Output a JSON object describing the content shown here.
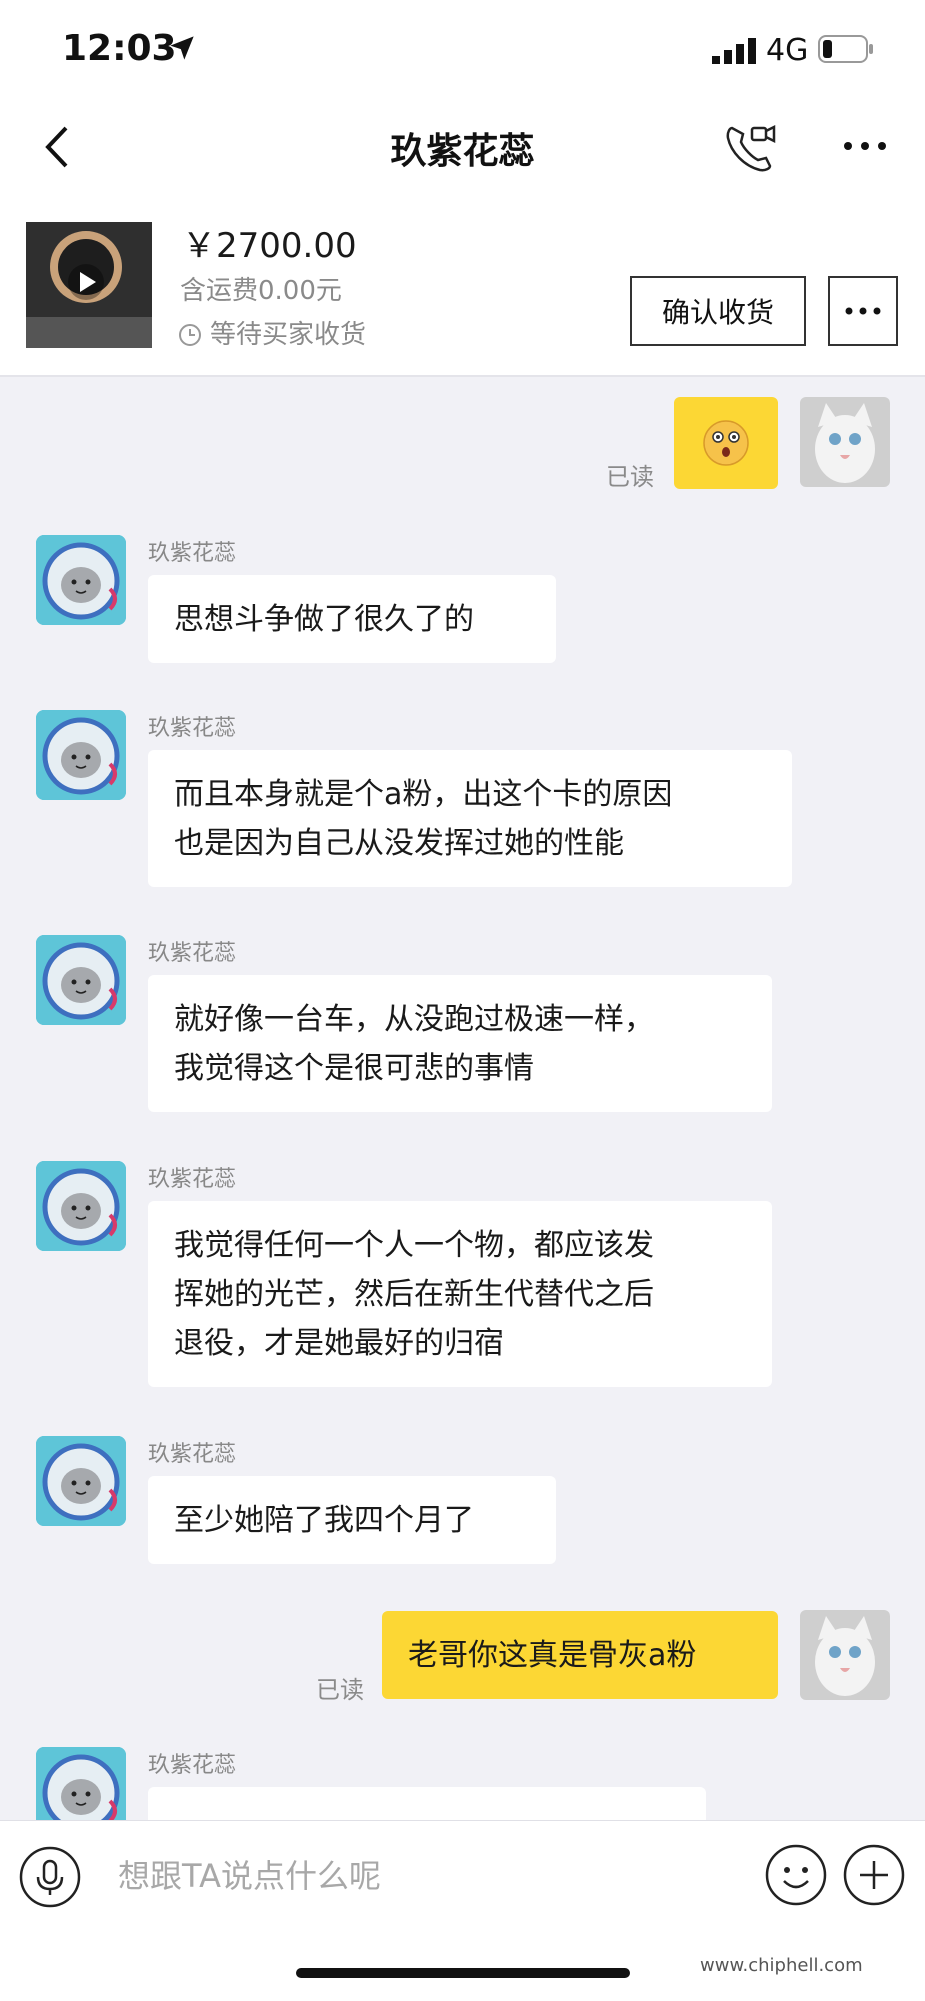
{
  "status_bar": {
    "time": "12:03",
    "network": "4G"
  },
  "nav": {
    "title": "玖紫花蕊"
  },
  "product": {
    "price": "￥2700.00",
    "shipping": "含运费0.00元",
    "status": "等待买家收货",
    "confirm_label": "确认收货"
  },
  "chat": {
    "read_label": "已读",
    "sender_name": "玖紫花蕊",
    "messages": [
      {
        "text": "思想斗争做了很久了的"
      },
      {
        "lines": [
          "而且本身就是个a粉，出这个卡的原因",
          "也是因为自己从没发挥过她的性能"
        ]
      },
      {
        "lines": [
          "就好像一台车，从没跑过极速一样，",
          "我觉得这个是很可悲的事情"
        ]
      },
      {
        "lines": [
          "我觉得任何一个人一个物，都应该发",
          "挥她的光芒，然后在新生代替代之后",
          "退役，才是她最好的归宿"
        ]
      },
      {
        "text": "至少她陪了我四个月了"
      },
      {
        "text": "老哥你这真是骨灰a粉"
      }
    ]
  },
  "input": {
    "placeholder": "想跟TA说点什么呢"
  },
  "watermark": "www.chiphell.com",
  "colors": {
    "accent_yellow": "#fcd734",
    "background": "#f1f1f6"
  },
  "icons": [
    "location-arrow-icon",
    "signal-icon",
    "battery-icon",
    "back-chevron-icon",
    "video-call-icon",
    "more-dots-icon",
    "clock-icon",
    "play-icon",
    "shocked-emoji-icon",
    "microphone-icon",
    "smile-icon",
    "plus-icon"
  ]
}
